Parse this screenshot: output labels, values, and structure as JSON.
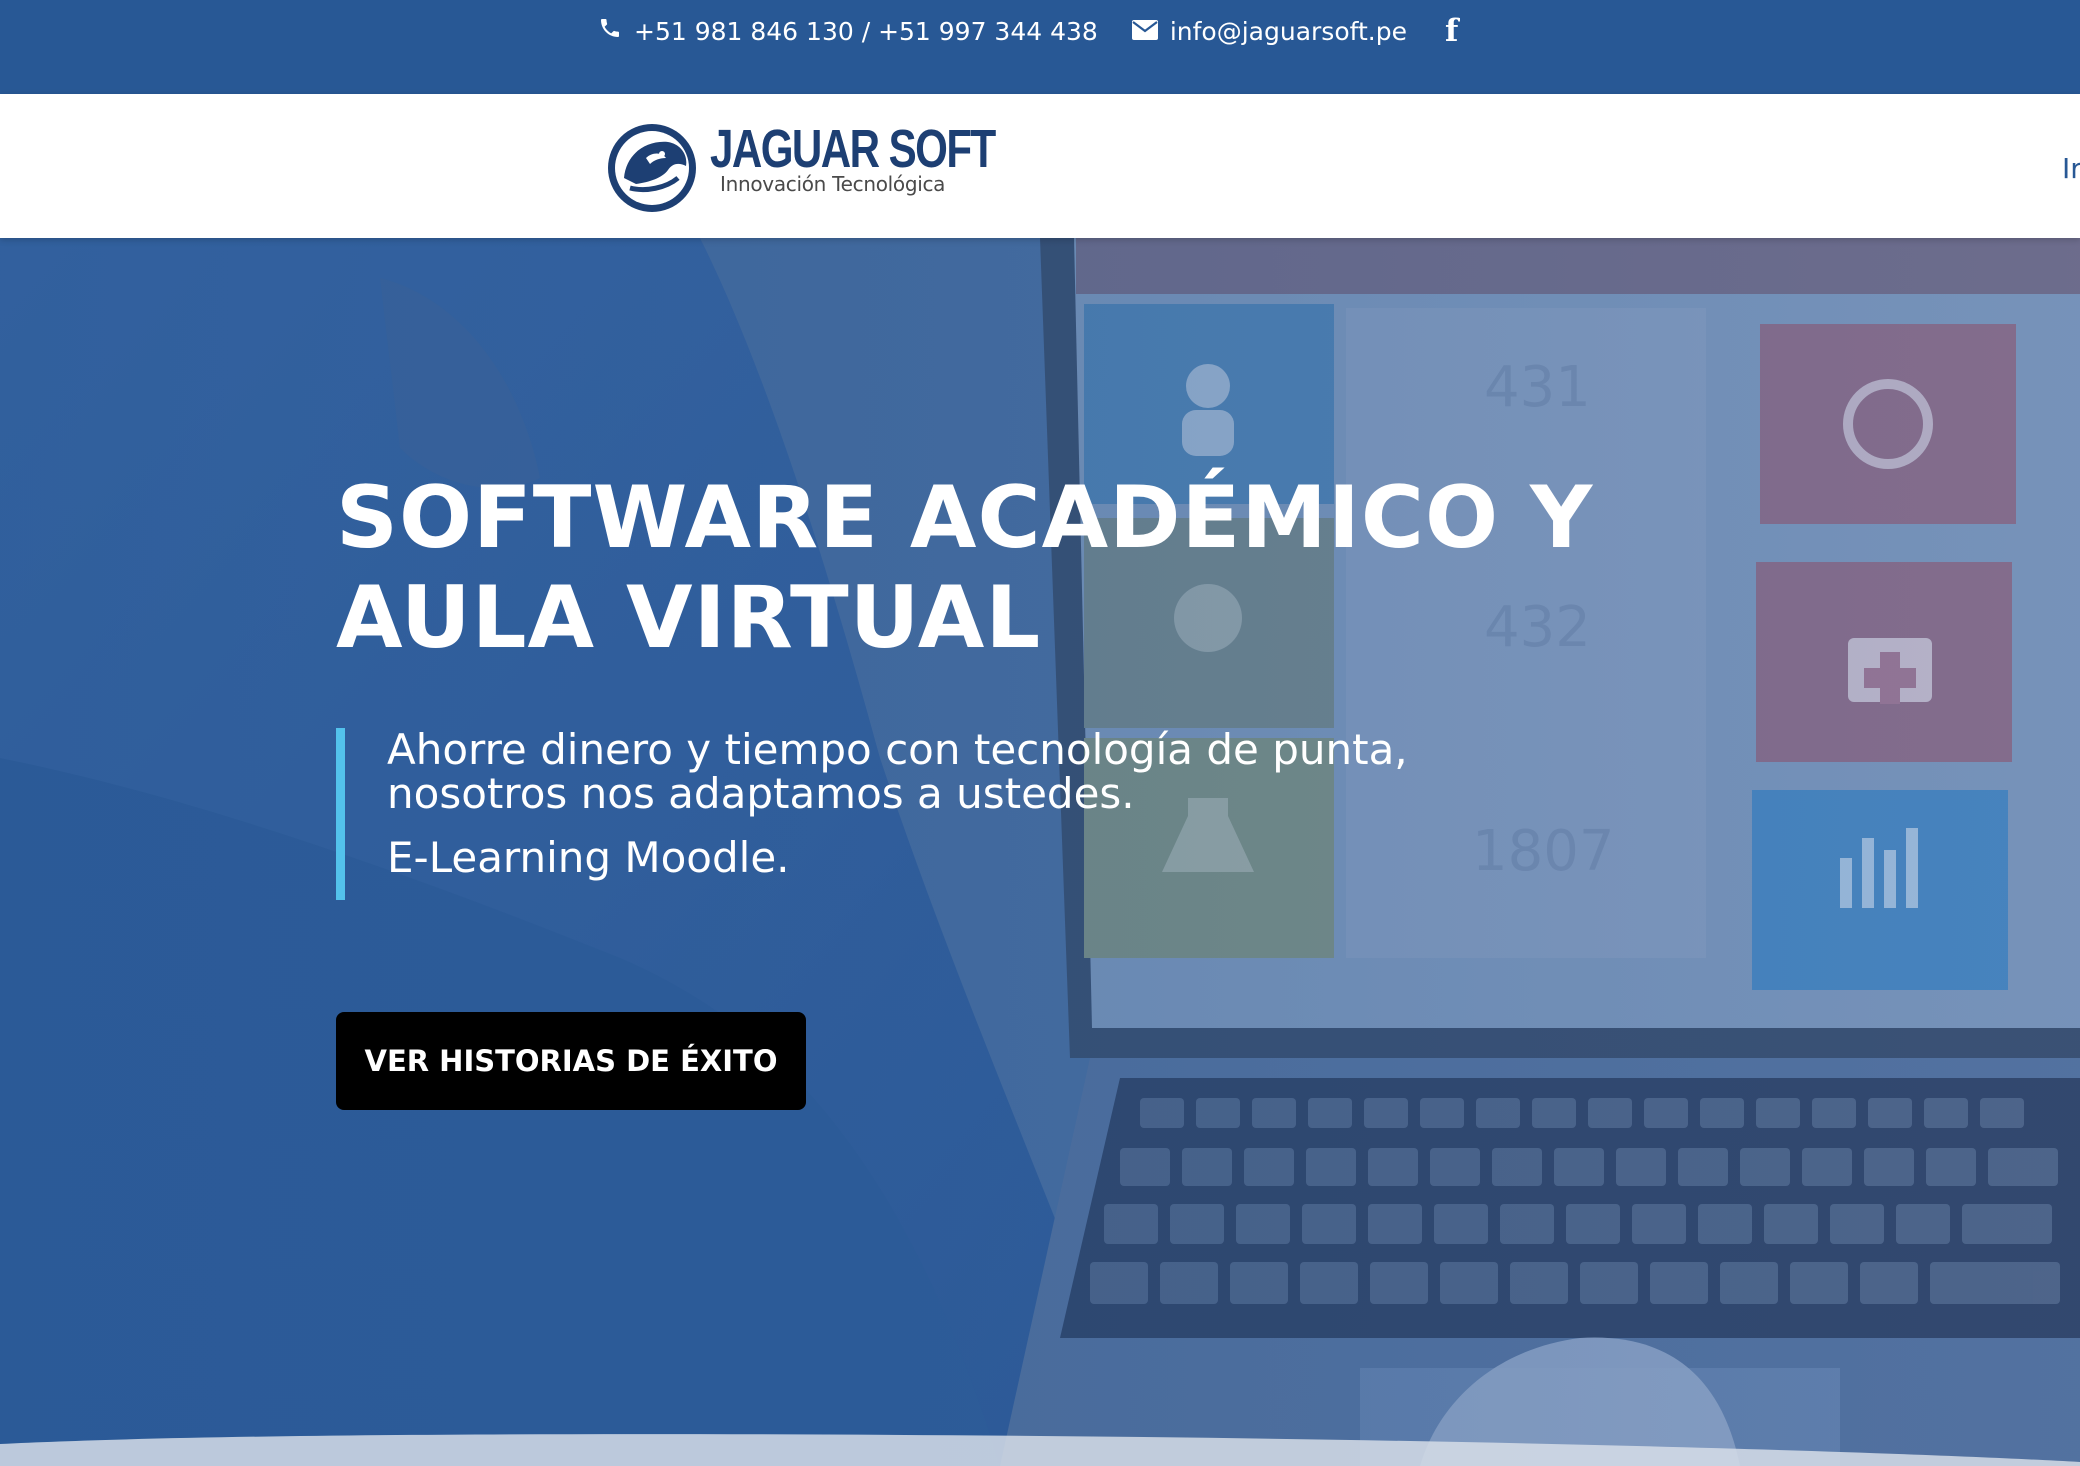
{
  "topbar": {
    "phone": "+51 981 846 130 / +51 997 344 438",
    "email": "info@jaguarsoft.pe",
    "facebook_glyph": "f",
    "icons": [
      "phone-icon",
      "mail-icon",
      "facebook-icon"
    ]
  },
  "header": {
    "logo_title": "JAGUAR SOFT",
    "logo_subtitle": "Innovación Tecnológica",
    "nav_partial": "Ir"
  },
  "hero": {
    "title_line1": "SOFTWARE ACADÉMICO Y",
    "title_line2": "AULA VIRTUAL",
    "subtitle": "Ahorre dinero y tiempo con tecnología de punta, nosotros nos adaptamos a ustedes.",
    "subtitle2": "E-Learning Moodle.",
    "cta_label": "VER HISTORIAS DE ÉXITO",
    "screen_numbers": [
      "431",
      "432",
      "1807"
    ]
  },
  "colors": {
    "brand_blue": "#285895",
    "accent_cyan": "#53c2ec",
    "cta_bg": "#000000"
  }
}
